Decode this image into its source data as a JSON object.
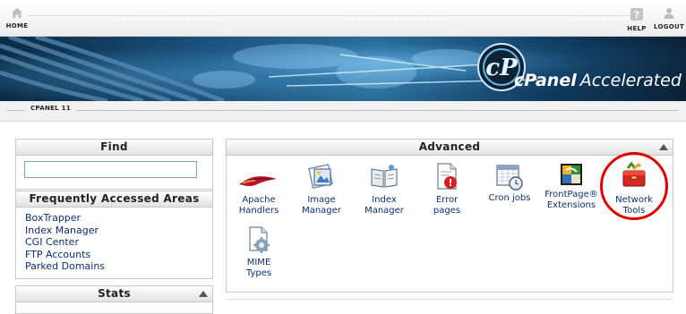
{
  "top_nav": {
    "home_label": "HOME",
    "help_label": "HELP",
    "logout_label": "LOGOUT"
  },
  "banner": {
    "logo_brand": "cPanel",
    "logo_suffix": "Accelerated"
  },
  "subbar": {
    "label": "CPANEL 11"
  },
  "find": {
    "title": "Find",
    "input_value": "",
    "input_placeholder": ""
  },
  "frequently_accessed": {
    "title": "Frequently Accessed Areas",
    "items": [
      "BoxTrapper",
      "Index Manager",
      "CGI Center",
      "FTP Accounts",
      "Parked Domains"
    ]
  },
  "stats": {
    "title": "Stats"
  },
  "advanced": {
    "title": "Advanced",
    "items": [
      {
        "line1": "Apache",
        "line2": "Handlers",
        "icon": "feather-icon"
      },
      {
        "line1": "Image",
        "line2": "Manager",
        "icon": "image-manager-icon"
      },
      {
        "line1": "Index",
        "line2": "Manager",
        "icon": "book-icon"
      },
      {
        "line1": "Error",
        "line2": "pages",
        "icon": "error-page-icon"
      },
      {
        "line1": "Cron jobs",
        "line2": "",
        "icon": "calendar-clock-icon"
      },
      {
        "line1": "FrontPage®",
        "line2": "Extensions",
        "icon": "frontpage-icon"
      },
      {
        "line1": "Network",
        "line2": "Tools",
        "icon": "toolbox-icon"
      },
      {
        "line1": "MIME",
        "line2": "Types",
        "icon": "mime-gear-icon"
      }
    ]
  },
  "colors": {
    "link": "#0b2f6e",
    "highlight": "#e00000",
    "banner_dark": "#0b2a45",
    "banner_light": "#2a6e99"
  }
}
